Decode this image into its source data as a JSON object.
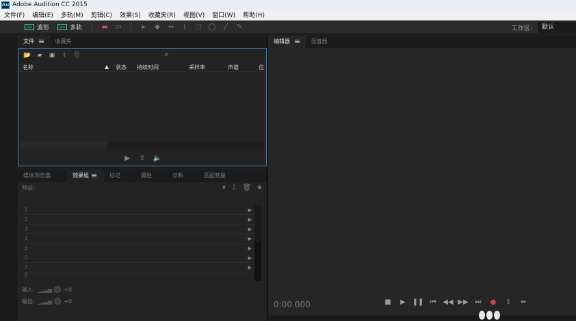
{
  "app": {
    "logo": "Au",
    "title": "Adobe Audition CC 2015"
  },
  "menu": [
    "文件(F)",
    "编辑(E)",
    "多轨(M)",
    "剪辑(C)",
    "效果(S)",
    "收藏夹(R)",
    "视图(V)",
    "窗口(W)",
    "帮助(H)"
  ],
  "toolbar": {
    "waveform_label": "波形",
    "multitrack_label": "多轨",
    "workspace_label": "工作区:",
    "workspace_value": "默认"
  },
  "files_panel": {
    "tabs": [
      "文件",
      "收藏夹"
    ],
    "columns": [
      "名称",
      "状态",
      "持续时间",
      "采样率",
      "声道",
      "位"
    ]
  },
  "effects_panel": {
    "tabs": [
      "媒体浏览器",
      "效果组",
      "标记",
      "属性",
      "诊断",
      "匹配音量"
    ],
    "preset_label": "预设:",
    "rack_slots": [
      "1",
      "2",
      "3",
      "4",
      "5",
      "6",
      "7",
      "8"
    ],
    "input_label": "输入:",
    "output_label": "输出:",
    "input_value": "+0",
    "output_value": "+0"
  },
  "editor_panel": {
    "tabs": [
      "编辑器",
      "混音器"
    ],
    "timecode": "0:00.000"
  },
  "colors": {
    "accent_blue": "#3f7fbf",
    "record_red": "#d94040",
    "wave_green": "#3fd08f"
  }
}
